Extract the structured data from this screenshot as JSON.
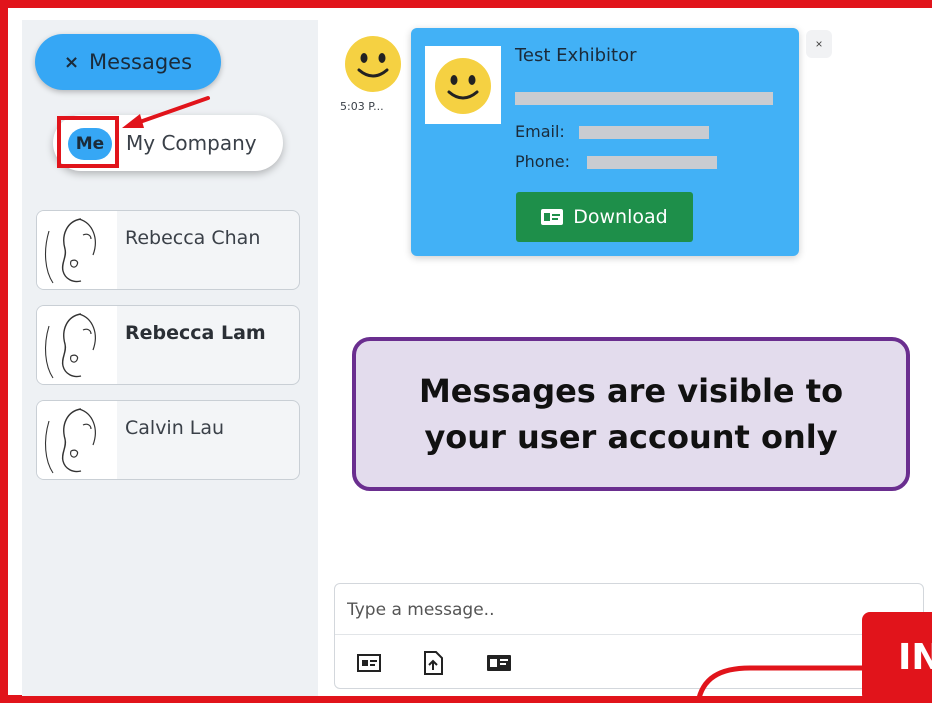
{
  "sidebar": {
    "messages_toggle": {
      "icon": "close-icon",
      "icon_glyph": "×",
      "label": "Messages"
    },
    "scope": {
      "me_label": "Me",
      "company_label": "My Company"
    },
    "contacts": [
      {
        "name": "Rebecca Chan",
        "bold": false
      },
      {
        "name": "Rebecca Lam",
        "bold": true
      },
      {
        "name": "Calvin Lau",
        "bold": false
      }
    ]
  },
  "chat": {
    "message": {
      "time": "5:03 P...",
      "card": {
        "title": "Test Exhibitor",
        "email_label": "Email:",
        "phone_label": "Phone:",
        "download_label": "Download",
        "close_glyph": "×"
      }
    },
    "notice": {
      "line1": "Messages are visible to",
      "line2": "your user account only"
    },
    "composer": {
      "placeholder": "Type a message..",
      "tools": [
        "image-icon",
        "file-upload-icon",
        "contact-card-icon"
      ]
    }
  },
  "overlay": {
    "badge_text": "IN"
  },
  "colors": {
    "accent_blue": "#36a7f5",
    "card_blue": "#42b1f6",
    "download_green": "#1e8f4a",
    "highlight_red": "#e1141b",
    "notice_purple": "#6a2e8f",
    "notice_bg": "#e3dced",
    "smiley_yellow": "#f5d142"
  }
}
